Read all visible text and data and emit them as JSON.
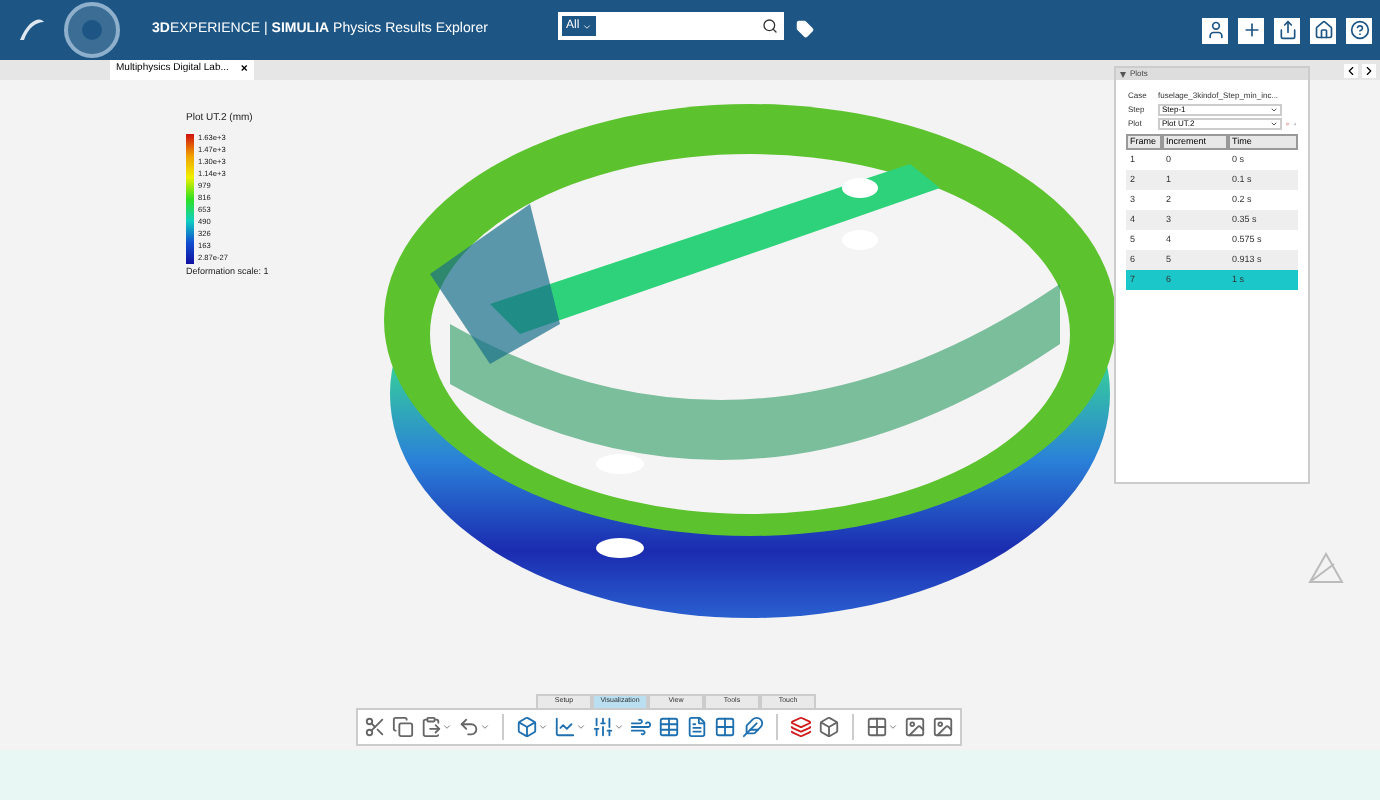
{
  "top_bar": {
    "title": "**3D**EXPERIENCE | **SIMULIA** Physics Results Explorer",
    "search": {
      "scope": "All"
    }
  },
  "document_tab": {
    "label": "Multiphysics Digital Lab...",
    "close": "×"
  },
  "legend": {
    "title": "Plot UT.2 (mm)",
    "values": [
      "1.63e+3",
      "1.47e+3",
      "1.30e+3",
      "1.14e+3",
      "979",
      "816",
      "653",
      "490",
      "326",
      "163",
      "2.87e-27"
    ],
    "footer": "Deformation scale: 1"
  },
  "plots_panel": {
    "title": "Plots",
    "expanded": true,
    "case_label": "Case",
    "case_value": "fuselage_3kindof_Step_min_inc...",
    "step_label": "Step",
    "step_value": "Step-1",
    "plot_label": "Plot",
    "plot_value": "Plot UT.2",
    "columns": [
      "Frame",
      "Increment",
      "Time"
    ],
    "rows": [
      {
        "cells": [
          "1",
          "0",
          "0 s"
        ],
        "selected": false
      },
      {
        "cells": [
          "2",
          "1",
          "0.1 s"
        ],
        "selected": false
      },
      {
        "cells": [
          "3",
          "2",
          "0.2 s"
        ],
        "selected": false
      },
      {
        "cells": [
          "4",
          "3",
          "0.35 s"
        ],
        "selected": false
      },
      {
        "cells": [
          "5",
          "4",
          "0.575 s"
        ],
        "selected": false
      },
      {
        "cells": [
          "6",
          "5",
          "0.913 s"
        ],
        "selected": false
      },
      {
        "cells": [
          "7",
          "6",
          "1 s"
        ],
        "selected": true
      }
    ]
  },
  "action_bar": {
    "tabs": [
      {
        "label": "Setup",
        "selected": false
      },
      {
        "label": "Visualization",
        "selected": true
      },
      {
        "label": "View",
        "selected": false
      },
      {
        "label": "Tools",
        "selected": false
      },
      {
        "label": "Touch",
        "selected": false
      }
    ]
  }
}
